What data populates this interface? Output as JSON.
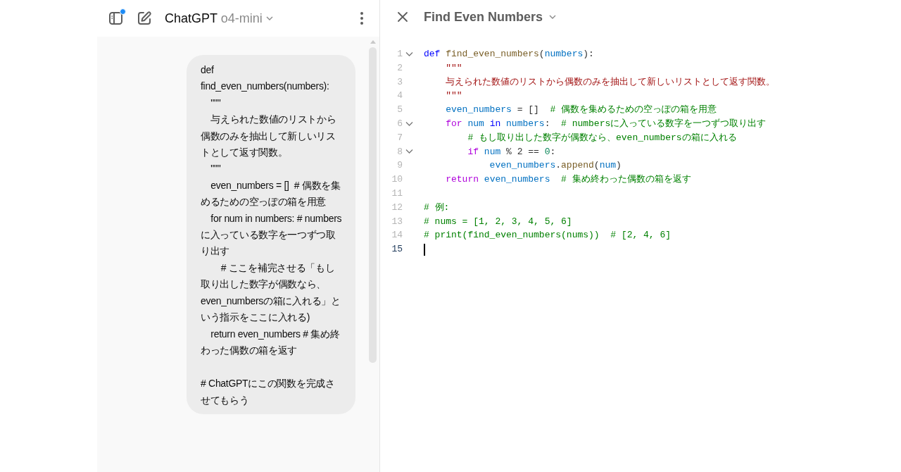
{
  "chat_header": {
    "title": "ChatGPT",
    "model": "o4-mini",
    "notification": true
  },
  "message": {
    "blocks": [
      {
        "lines": [
          "def find_even_numbers(numbers):",
          "    \"\"\"",
          "    与えられた数値のリストから偶数のみを抽出して新しいリストとして返す関数。",
          "    \"\"\"",
          "    even_numbers = []  # 偶数を集めるための空っぽの箱を用意",
          "    for num in numbers: # numbersに入っている数字を一つずつ取り出す",
          "        # ここを補完させる「もし取り出した数字が偶数なら、even_numbersの箱に入れる」という指示をここに入れる)",
          "    return even_numbers # 集め終わった偶数の箱を返す"
        ]
      },
      {
        "lines": [
          "# ChatGPTにこの関数を完成させてもらう"
        ]
      }
    ]
  },
  "editor": {
    "title": "Find Even Numbers",
    "lines": [
      {
        "number": "1",
        "fold": true,
        "current": false,
        "tokens": [
          {
            "t": "def ",
            "kind": "keyword"
          },
          {
            "t": "find_even_numbers",
            "kind": "function"
          },
          {
            "t": "(",
            "kind": "plain"
          },
          {
            "t": "numbers",
            "kind": "variable"
          },
          {
            "t": "):",
            "kind": "plain"
          }
        ]
      },
      {
        "number": "2",
        "fold": false,
        "current": false,
        "tokens": [
          {
            "t": "    \"\"\"",
            "kind": "string"
          }
        ]
      },
      {
        "number": "3",
        "fold": false,
        "current": false,
        "tokens": [
          {
            "t": "    与えられた数値のリストから偶数のみを抽出して新しいリストとして返す関数。",
            "kind": "string"
          }
        ]
      },
      {
        "number": "4",
        "fold": false,
        "current": false,
        "tokens": [
          {
            "t": "    \"\"\"",
            "kind": "string"
          }
        ]
      },
      {
        "number": "5",
        "fold": false,
        "current": false,
        "tokens": [
          {
            "t": "    even_numbers",
            "kind": "variable"
          },
          {
            "t": " = []  ",
            "kind": "plain"
          },
          {
            "t": "# 偶数を集めるための空っぽの箱を用意",
            "kind": "comment"
          }
        ]
      },
      {
        "number": "6",
        "fold": true,
        "current": false,
        "tokens": [
          {
            "t": "    for ",
            "kind": "control"
          },
          {
            "t": "num ",
            "kind": "variable"
          },
          {
            "t": "in ",
            "kind": "keyword"
          },
          {
            "t": "numbers",
            "kind": "variable"
          },
          {
            "t": ":  ",
            "kind": "plain"
          },
          {
            "t": "# numbersに入っている数字を一つずつ取り出す",
            "kind": "comment"
          }
        ]
      },
      {
        "number": "7",
        "fold": false,
        "current": false,
        "tokens": [
          {
            "t": "        # もし取り出した数字が偶数なら、even_numbersの箱に入れる",
            "kind": "comment"
          }
        ]
      },
      {
        "number": "8",
        "fold": true,
        "current": false,
        "tokens": [
          {
            "t": "        if ",
            "kind": "control"
          },
          {
            "t": "num",
            "kind": "variable"
          },
          {
            "t": " % 2 == ",
            "kind": "plain"
          },
          {
            "t": "0",
            "kind": "number"
          },
          {
            "t": ":",
            "kind": "plain"
          }
        ]
      },
      {
        "number": "9",
        "fold": false,
        "current": false,
        "tokens": [
          {
            "t": "            even_numbers",
            "kind": "variable"
          },
          {
            "t": ".",
            "kind": "plain"
          },
          {
            "t": "append",
            "kind": "function"
          },
          {
            "t": "(",
            "kind": "plain"
          },
          {
            "t": "num",
            "kind": "variable"
          },
          {
            "t": ")",
            "kind": "plain"
          }
        ]
      },
      {
        "number": "10",
        "fold": false,
        "current": false,
        "tokens": [
          {
            "t": "    return ",
            "kind": "control"
          },
          {
            "t": "even_numbers  ",
            "kind": "variable"
          },
          {
            "t": "# 集め終わった偶数の箱を返す",
            "kind": "comment"
          }
        ]
      },
      {
        "number": "11",
        "fold": false,
        "current": false
      },
      {
        "number": "12",
        "fold": false,
        "current": false,
        "tokens": [
          {
            "t": "# 例:",
            "kind": "comment"
          }
        ]
      },
      {
        "number": "13",
        "fold": false,
        "current": false,
        "tokens": [
          {
            "t": "# nums = [1, 2, 3, 4, 5, 6]",
            "kind": "comment"
          }
        ]
      },
      {
        "number": "14",
        "fold": false,
        "current": false,
        "tokens": [
          {
            "t": "# print(find_even_numbers(nums))  # [2, 4, 6]",
            "kind": "comment"
          }
        ]
      },
      {
        "number": "15",
        "fold": false,
        "current": true
      }
    ]
  }
}
